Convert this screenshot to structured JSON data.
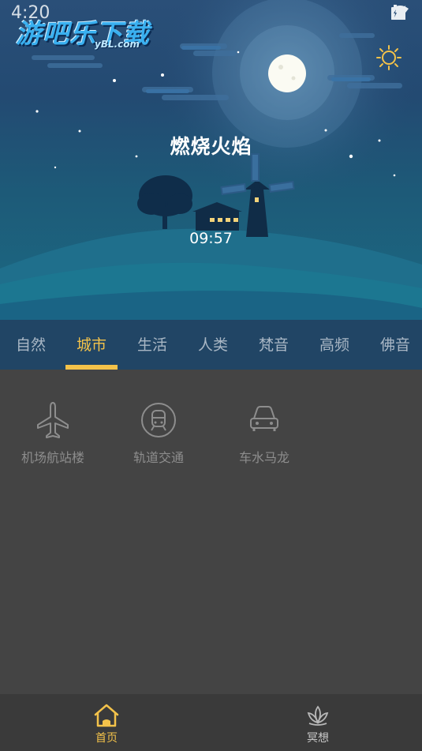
{
  "status_bar": {
    "time": "4:20"
  },
  "logo": {
    "text": "游吧乐下载",
    "sub": "yBL.com"
  },
  "hero": {
    "title": "燃烧火焰",
    "timer": "09:57"
  },
  "tabs": [
    {
      "label": "自然"
    },
    {
      "label": "城市",
      "active": true
    },
    {
      "label": "生活"
    },
    {
      "label": "人类"
    },
    {
      "label": "梵音"
    },
    {
      "label": "高频"
    },
    {
      "label": "佛音"
    }
  ],
  "sounds": [
    {
      "label": "机场航站楼",
      "icon": "airplane-icon"
    },
    {
      "label": "轨道交通",
      "icon": "train-icon"
    },
    {
      "label": "车水马龙",
      "icon": "car-icon"
    }
  ],
  "bottom_nav": [
    {
      "label": "首页",
      "icon": "home-icon",
      "active": true
    },
    {
      "label": "冥想",
      "icon": "lotus-icon"
    }
  ],
  "colors": {
    "accent": "#f3c24a",
    "tab_bar": "#214565",
    "content_bg": "#444444",
    "nav_bg": "#3a3a3a"
  }
}
